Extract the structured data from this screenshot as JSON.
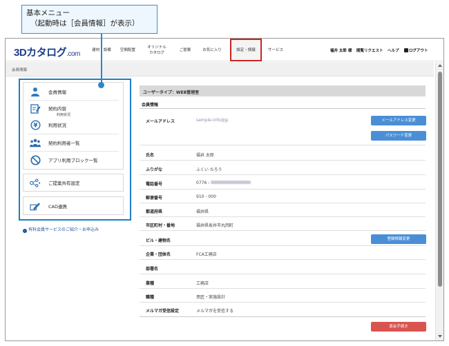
{
  "annotation": {
    "line1": "基本メニュー",
    "line2": "（起動時は［会員情報］が表示）"
  },
  "header": {
    "logo_main": "3Dカタログ",
    "logo_suffix": ".com",
    "nav": [
      "建材・設備",
      "空間配置",
      "オリジナル\nカタログ",
      "ご提案",
      "お気に入り",
      "設定・情報",
      "サービス"
    ],
    "user_name": "福井 太郎 様",
    "request": "閲覧リクエスト",
    "help": "ヘルプ",
    "logout": "ログアウト"
  },
  "breadcrumb": "会員情報",
  "side_menu": {
    "group1": [
      {
        "label": "会員情報",
        "icon": "person-icon"
      },
      {
        "label": "契約内容",
        "icon": "contract-edit-icon"
      },
      {
        "label": "利用状況",
        "icon": "yen-coin-icon"
      },
      {
        "label": "契約利用者一覧",
        "icon": "users-group-icon"
      },
      {
        "label": "アプリ利用ブロック一覧",
        "icon": "block-icon"
      }
    ],
    "sub_label": "利用状況",
    "group2": {
      "label": "ご提案共有設定",
      "icon": "share-icon"
    },
    "group3": {
      "label": "CAD連携",
      "icon": "cad-pencil-icon"
    },
    "promo": "有料会員サービスのご紹介・お申込み"
  },
  "panel": {
    "user_type": "ユーザータイプ：WEB管理室",
    "section_title": "会員情報",
    "email_label": "メールアドレス",
    "email_value": "sample-info@jp",
    "btn_email": "メールアドレス変更",
    "btn_password": "パスワード変更",
    "rows": [
      {
        "label": "氏名",
        "value": "福井 太郎"
      },
      {
        "label": "ふりがな",
        "value": "ふくい たろう"
      },
      {
        "label": "電話番号",
        "value": "0776 -"
      },
      {
        "label": "郵便番号",
        "value": "910 - 000"
      },
      {
        "label": "都道府県",
        "value": "福井県"
      },
      {
        "label": "市区町村・番地",
        "value": "福井県坂井市丸岡町"
      },
      {
        "label": "ビル・建物名",
        "value": ""
      },
      {
        "label": "企業・団体名",
        "value": "FCA工務店"
      },
      {
        "label": "部署名",
        "value": ""
      },
      {
        "label": "業種",
        "value": "工務店"
      },
      {
        "label": "職種",
        "value": "意匠・実施設計"
      },
      {
        "label": "メルマガ受信設定",
        "value": "メルマガを受信する"
      }
    ],
    "btn_register": "登録情報変更",
    "btn_withdraw": "退会手続き"
  }
}
